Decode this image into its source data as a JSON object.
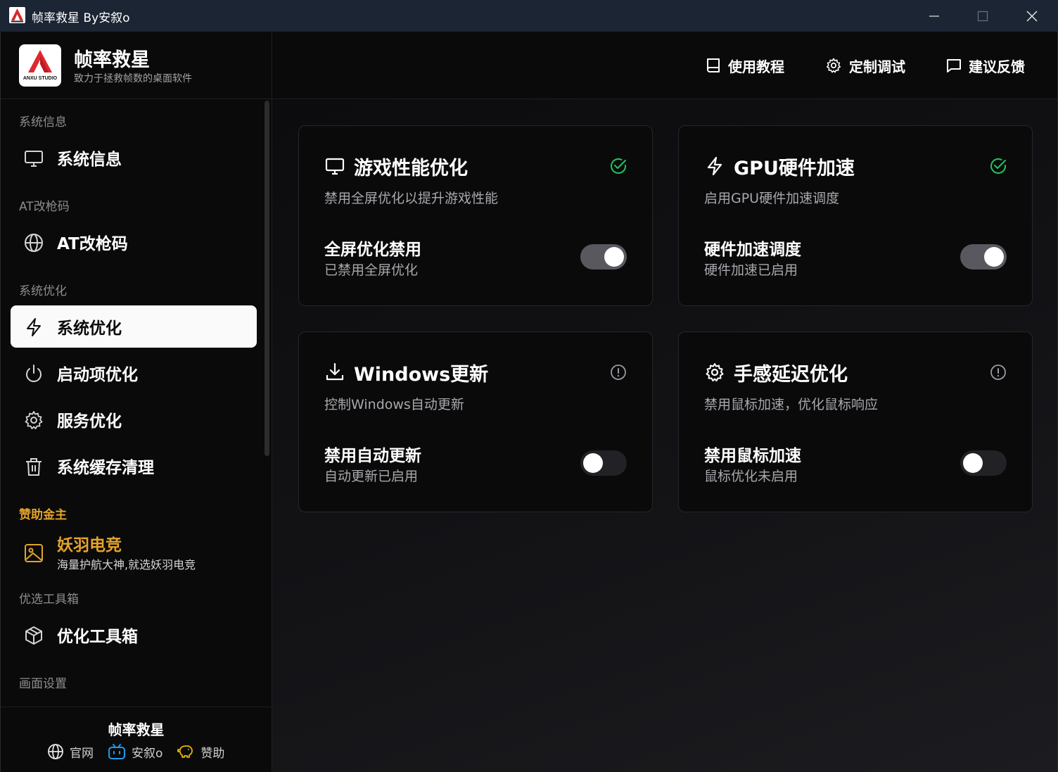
{
  "window": {
    "title": "帧率救星 By安叙o",
    "logo_text": "ANXU STUDIO"
  },
  "brand": {
    "name": "帧率救星",
    "tagline": "致力于拯救帧数的桌面软件",
    "logo_text": "ANXU STUDIO"
  },
  "header": {
    "buttons": [
      {
        "label": "使用教程",
        "icon": "book-icon"
      },
      {
        "label": "定制调试",
        "icon": "gear-icon"
      },
      {
        "label": "建议反馈",
        "icon": "message-icon"
      }
    ]
  },
  "sidebar": {
    "sections": {
      "system_info": "系统信息",
      "at": "AT改枪码",
      "optimization": "系统优化",
      "sponsor": "赞助金主",
      "toolbox": "优选工具箱",
      "display": "画面设置"
    },
    "items": {
      "system_info": "系统信息",
      "at_code": "AT改枪码",
      "system_opt": "系统优化",
      "startup_opt": "启动项优化",
      "service_opt": "服务优化",
      "cache_clean": "系统缓存清理",
      "toolbox": "优化工具箱"
    },
    "active": "系统优化",
    "sponsor": {
      "name": "妖羽电竞",
      "desc": "海量护航大神,就选妖羽电竞"
    }
  },
  "footer": {
    "name": "帧率救星",
    "links": [
      "官网",
      "安叙o",
      "赞助"
    ]
  },
  "cards": [
    {
      "title": "游戏性能优化",
      "desc": "禁用全屏优化以提升游戏性能",
      "setting": "全屏优化禁用",
      "setting_desc": "已禁用全屏优化",
      "enabled": true,
      "status": "check-icon"
    },
    {
      "title": "GPU硬件加速",
      "desc": "启用GPU硬件加速调度",
      "setting": "硬件加速调度",
      "setting_desc": "硬件加速已启用",
      "enabled": true,
      "status": "check-icon"
    },
    {
      "title": "Windows更新",
      "desc": "控制Windows自动更新",
      "setting": "禁用自动更新",
      "setting_desc": "自动更新已启用",
      "enabled": false,
      "status": "info-icon"
    },
    {
      "title": "手感延迟优化",
      "desc": "禁用鼠标加速，优化鼠标响应",
      "setting": "禁用鼠标加速",
      "setting_desc": "鼠标优化未启用",
      "enabled": false,
      "status": "info-icon"
    }
  ],
  "colors": {
    "accent_gold": "#e4a32b",
    "success_green": "#22c55e",
    "titlebar": "#1b2533"
  }
}
